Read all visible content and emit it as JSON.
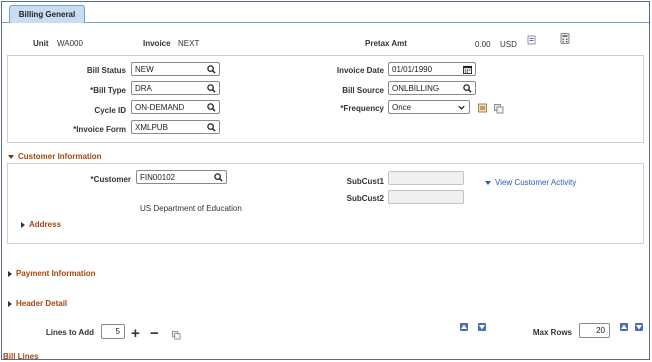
{
  "tab": {
    "label": "Billing General"
  },
  "summary": {
    "unit_label": "Unit",
    "unit_value": "WA000",
    "invoice_label": "Invoice",
    "invoice_value": "NEXT",
    "pretax_label": "Pretax Amt",
    "pretax_value": "0.00",
    "currency": "USD"
  },
  "form": {
    "bill_status": {
      "label": "Bill Status",
      "value": "NEW"
    },
    "bill_type": {
      "label": "*Bill Type",
      "value": "DRA"
    },
    "cycle_id": {
      "label": "Cycle ID",
      "value": "ON-DEMAND"
    },
    "invoice_form": {
      "label": "*Invoice Form",
      "value": "XMLPUB"
    },
    "invoice_date": {
      "label": "Invoice Date",
      "value": "01/01/1990"
    },
    "bill_source": {
      "label": "Bill Source",
      "value": "ONLBILLING"
    },
    "frequency": {
      "label": "*Frequency",
      "value": "Once"
    }
  },
  "customer_info": {
    "header": "Customer Information",
    "customer_label": "*Customer",
    "customer_value": "FIN00102",
    "customer_name": "US Department of Education",
    "subcust1_label": "SubCust1",
    "subcust1_value": "",
    "subcust2_label": "SubCust2",
    "subcust2_value": "",
    "view_activity_link": "View Customer Activity",
    "address_header": "Address"
  },
  "sections": {
    "payment_info": "Payment Information",
    "header_detail": "Header Detail",
    "bill_lines": "Bill Lines"
  },
  "lines": {
    "lines_to_add_label": "Lines to Add",
    "lines_to_add_value": "5",
    "add_symbol": "+",
    "remove_symbol": "−",
    "max_rows_label": "Max Rows",
    "max_rows_value": "20"
  },
  "colors": {
    "section_header": "#a3470e",
    "link": "#2a5db0",
    "tab_bg": "#c8ddf1"
  }
}
